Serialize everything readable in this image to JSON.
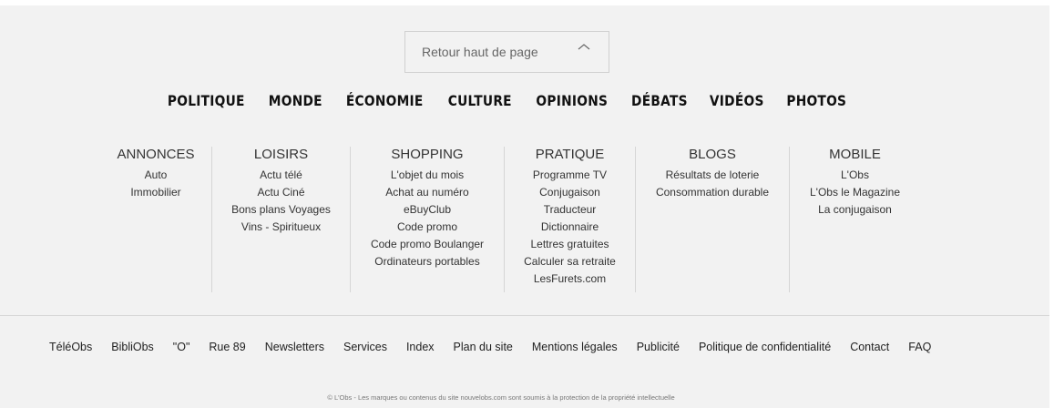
{
  "back_to_top": {
    "label": "Retour haut de page",
    "icon": "chevron-up-icon"
  },
  "categories": [
    "POLITIQUE",
    "MONDE",
    "ÉCONOMIE",
    "CULTURE",
    "OPINIONS",
    "DÉBATS",
    "VIDÉOS",
    "PHOTOS"
  ],
  "columns": [
    {
      "title": "ANNONCES",
      "items": [
        "Auto",
        "Immobilier"
      ]
    },
    {
      "title": "LOISIRS",
      "items": [
        "Actu télé",
        "Actu Ciné",
        "Bons plans Voyages",
        "Vins - Spiritueux"
      ]
    },
    {
      "title": "SHOPPING",
      "items": [
        "L'objet du mois",
        "Achat au numéro",
        "eBuyClub",
        "Code promo",
        "Code promo Boulanger",
        "Ordinateurs portables"
      ]
    },
    {
      "title": "PRATIQUE",
      "items": [
        "Programme TV",
        "Conjugaison",
        "Traducteur",
        "Dictionnaire",
        "Lettres gratuites",
        "Calculer sa retraite",
        "LesFurets.com"
      ]
    },
    {
      "title": "BLOGS",
      "items": [
        "Résultats de loterie",
        "Consommation durable"
      ]
    },
    {
      "title": "MOBILE",
      "items": [
        "L'Obs",
        "L'Obs le Magazine",
        "La conjugaison"
      ]
    }
  ],
  "bottom_links": [
    "TéléObs",
    "BibliObs",
    "\"O\"",
    "Rue 89",
    "Newsletters",
    "Services",
    "Index",
    "Plan du site",
    "Mentions légales",
    "Publicité",
    "Politique de confidentialité",
    "Contact",
    "FAQ"
  ],
  "copyright": "© L'Obs - Les marques ou contenus du site nouvelobs.com sont soumis à la protection de la propriété intellectuelle"
}
